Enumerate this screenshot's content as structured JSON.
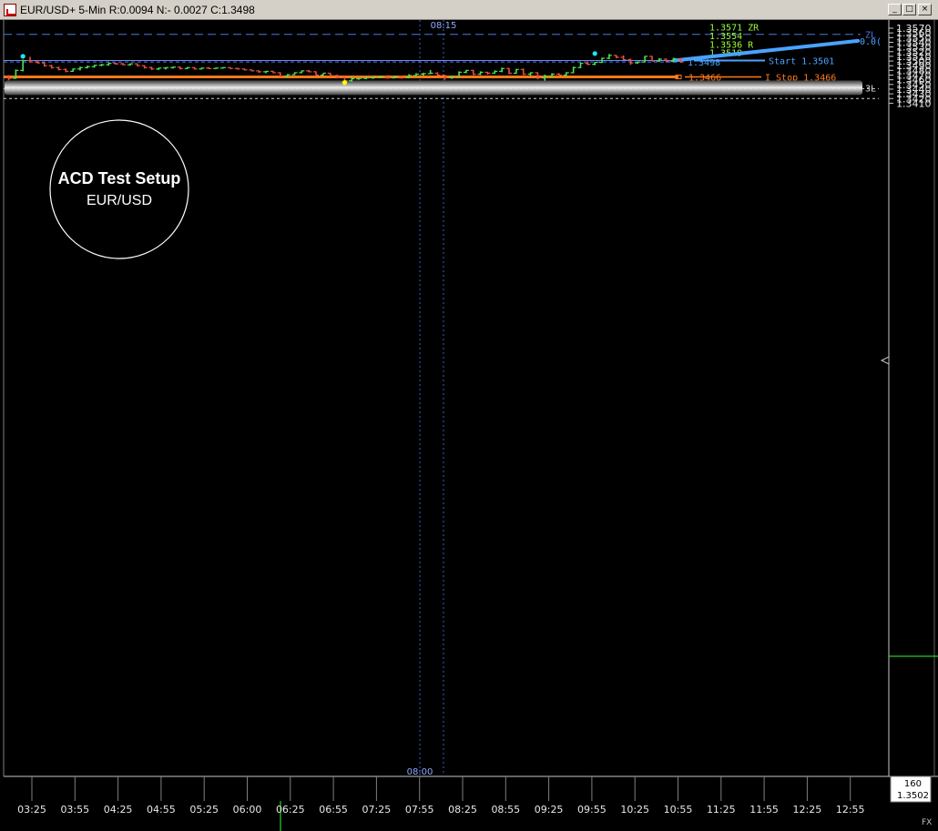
{
  "window": {
    "title": "EUR/USD+ 5-Min R:0.0094 N:- 0.0027 C:1.3498",
    "buttons": {
      "minimize": "_",
      "maximize": "□",
      "close": "×"
    }
  },
  "badge": {
    "line1": "ACD Test Setup",
    "line2": "EUR/USD"
  },
  "top_time_marker": "08:15",
  "bottom_time_marker": "08:00",
  "status_box": {
    "line1": "160",
    "line2": "1.3502"
  },
  "fx_label": "FX",
  "colors": {
    "up_bar": "#4fe34f",
    "down_bar": "#e8503c",
    "stop_line": "#ff7a1a",
    "projection": "#4aa3ff",
    "level_text": "#9cff3c",
    "marker_cyan": "#22e3f0",
    "marker_yellow": "#ffff00",
    "blue_line": "#4a78e0"
  },
  "chart_data": {
    "type": "bar",
    "title": "EUR/USD+ 5-Min",
    "ylim": [
      1.3405,
      1.3575
    ],
    "y_ticks": [
      "1.3570",
      "1.3560",
      "1.3550",
      "1.3540",
      "1.3530",
      "1.3520",
      "1.3510",
      "1.3500",
      "1.3490",
      "1.3480",
      "1.3470",
      "1.3460",
      "1.3450",
      "1.3440",
      "1.3430",
      "1.3420",
      "1.3410"
    ],
    "x_ticks": [
      "03:25",
      "03:55",
      "04:25",
      "04:55",
      "05:25",
      "06:00",
      "06:25",
      "06:55",
      "07:25",
      "07:55",
      "08:25",
      "08:55",
      "09:25",
      "09:55",
      "10:25",
      "10:55",
      "11:25",
      "11:55",
      "12:25",
      "12:55"
    ],
    "bars_ohlc": [
      [
        1.3466,
        1.347,
        1.3459,
        1.3463
      ],
      [
        1.3463,
        1.3482,
        1.3462,
        1.348
      ],
      [
        1.348,
        1.3503,
        1.3478,
        1.3501
      ],
      [
        1.3501,
        1.3509,
        1.3497,
        1.3498
      ],
      [
        1.3498,
        1.3502,
        1.3495,
        1.3496
      ],
      [
        1.3496,
        1.3497,
        1.3488,
        1.349
      ],
      [
        1.349,
        1.3492,
        1.3484,
        1.3486
      ],
      [
        1.3486,
        1.3488,
        1.348,
        1.3482
      ],
      [
        1.3482,
        1.3484,
        1.3476,
        1.3478
      ],
      [
        1.3478,
        1.3484,
        1.3477,
        1.3483
      ],
      [
        1.3483,
        1.3488,
        1.348,
        1.3486
      ],
      [
        1.3486,
        1.349,
        1.3484,
        1.3488
      ],
      [
        1.3488,
        1.3492,
        1.3486,
        1.3491
      ],
      [
        1.3491,
        1.3494,
        1.3489,
        1.3492
      ],
      [
        1.3492,
        1.3497,
        1.349,
        1.3495
      ],
      [
        1.3495,
        1.3496,
        1.3492,
        1.3494
      ],
      [
        1.3494,
        1.3496,
        1.3491,
        1.3492
      ],
      [
        1.3492,
        1.3495,
        1.349,
        1.3494
      ],
      [
        1.3494,
        1.3495,
        1.3489,
        1.349
      ],
      [
        1.349,
        1.3491,
        1.3484,
        1.3486
      ],
      [
        1.3486,
        1.3488,
        1.3481,
        1.3483
      ],
      [
        1.3483,
        1.3486,
        1.3481,
        1.3485
      ],
      [
        1.3485,
        1.3487,
        1.3482,
        1.3486
      ],
      [
        1.3486,
        1.3488,
        1.3484,
        1.3487
      ],
      [
        1.3487,
        1.3488,
        1.3482,
        1.3484
      ],
      [
        1.3484,
        1.3487,
        1.3483,
        1.3486
      ],
      [
        1.3486,
        1.3487,
        1.3482,
        1.3483
      ],
      [
        1.3483,
        1.3486,
        1.3482,
        1.3485
      ],
      [
        1.3485,
        1.3487,
        1.3483,
        1.3484
      ],
      [
        1.3484,
        1.3486,
        1.3483,
        1.3485
      ],
      [
        1.3485,
        1.3487,
        1.3484,
        1.3486
      ],
      [
        1.3486,
        1.3487,
        1.3483,
        1.3484
      ],
      [
        1.3484,
        1.3486,
        1.3482,
        1.3483
      ],
      [
        1.3483,
        1.3484,
        1.348,
        1.3481
      ],
      [
        1.3481,
        1.3482,
        1.3478,
        1.3479
      ],
      [
        1.3479,
        1.348,
        1.3475,
        1.3477
      ],
      [
        1.3477,
        1.3479,
        1.3474,
        1.3478
      ],
      [
        1.3478,
        1.3479,
        1.3474,
        1.3475
      ],
      [
        1.3475,
        1.3476,
        1.3466,
        1.3468
      ],
      [
        1.3468,
        1.3472,
        1.3465,
        1.3471
      ],
      [
        1.3471,
        1.3476,
        1.347,
        1.3475
      ],
      [
        1.3475,
        1.348,
        1.3474,
        1.3479
      ],
      [
        1.3479,
        1.3481,
        1.3476,
        1.3477
      ],
      [
        1.3477,
        1.3478,
        1.3468,
        1.347
      ],
      [
        1.347,
        1.3474,
        1.3468,
        1.3474
      ],
      [
        1.3474,
        1.3475,
        1.3467,
        1.3469
      ],
      [
        1.3469,
        1.3471,
        1.3463,
        1.3465
      ],
      [
        1.3465,
        1.3467,
        1.3455,
        1.3458
      ],
      [
        1.3458,
        1.3467,
        1.3456,
        1.3462
      ],
      [
        1.3462,
        1.3465,
        1.346,
        1.3463
      ],
      [
        1.3463,
        1.3466,
        1.3461,
        1.3464
      ],
      [
        1.3464,
        1.3467,
        1.3462,
        1.3466
      ],
      [
        1.3466,
        1.3468,
        1.3464,
        1.3467
      ],
      [
        1.3467,
        1.347,
        1.3462,
        1.3464
      ],
      [
        1.3464,
        1.3468,
        1.3463,
        1.3467
      ],
      [
        1.3467,
        1.3468,
        1.3462,
        1.3465
      ],
      [
        1.3465,
        1.3472,
        1.3463,
        1.3469
      ],
      [
        1.3469,
        1.3474,
        1.3467,
        1.3472
      ],
      [
        1.3472,
        1.3475,
        1.3469,
        1.3473
      ],
      [
        1.3473,
        1.3481,
        1.3472,
        1.3474
      ],
      [
        1.3474,
        1.3476,
        1.3469,
        1.347
      ],
      [
        1.347,
        1.3471,
        1.346,
        1.3465
      ],
      [
        1.3465,
        1.3468,
        1.3462,
        1.3467
      ],
      [
        1.3467,
        1.3478,
        1.3466,
        1.3476
      ],
      [
        1.3476,
        1.3481,
        1.3474,
        1.348
      ],
      [
        1.348,
        1.3481,
        1.347,
        1.3472
      ],
      [
        1.3472,
        1.3478,
        1.347,
        1.3476
      ],
      [
        1.3476,
        1.3477,
        1.3471,
        1.3474
      ],
      [
        1.3474,
        1.348,
        1.3473,
        1.3478
      ],
      [
        1.3478,
        1.3486,
        1.3476,
        1.3484
      ],
      [
        1.3484,
        1.3485,
        1.3472,
        1.3474
      ],
      [
        1.3474,
        1.3483,
        1.3473,
        1.3482
      ],
      [
        1.3482,
        1.3484,
        1.347,
        1.3472
      ],
      [
        1.3472,
        1.3476,
        1.3469,
        1.3475
      ],
      [
        1.3475,
        1.3476,
        1.3461,
        1.3464
      ],
      [
        1.3464,
        1.3471,
        1.3458,
        1.3468
      ],
      [
        1.3468,
        1.3474,
        1.3466,
        1.3472
      ],
      [
        1.3472,
        1.3474,
        1.3467,
        1.347
      ],
      [
        1.347,
        1.3476,
        1.3468,
        1.3475
      ],
      [
        1.3475,
        1.3488,
        1.3474,
        1.3486
      ],
      [
        1.3486,
        1.3497,
        1.3485,
        1.3495
      ],
      [
        1.3495,
        1.3499,
        1.3491,
        1.3493
      ],
      [
        1.3493,
        1.3498,
        1.3491,
        1.3497
      ],
      [
        1.3497,
        1.3507,
        1.3496,
        1.3506
      ],
      [
        1.3506,
        1.3515,
        1.3504,
        1.3512
      ],
      [
        1.3512,
        1.3513,
        1.3506,
        1.3508
      ],
      [
        1.3508,
        1.3512,
        1.3502,
        1.3503
      ],
      [
        1.3503,
        1.3505,
        1.3492,
        1.3496
      ],
      [
        1.3496,
        1.3499,
        1.3494,
        1.3498
      ],
      [
        1.3498,
        1.3511,
        1.3497,
        1.351
      ],
      [
        1.351,
        1.3511,
        1.3499,
        1.35
      ],
      [
        1.35,
        1.3506,
        1.3498,
        1.3504
      ],
      [
        1.3504,
        1.3505,
        1.3497,
        1.3499
      ],
      [
        1.3499,
        1.3507,
        1.3498,
        1.3505
      ],
      [
        1.3505,
        1.3506,
        1.3496,
        1.3498
      ]
    ],
    "levels": [
      {
        "name": "ZL",
        "label": "ZL",
        "price": 1.3557,
        "style": "dashed",
        "color": "#4a78e0"
      },
      {
        "name": "Start",
        "label": "Start 1.3501",
        "price": 1.3501,
        "color": "#4aa3ff"
      },
      {
        "name": "Close",
        "label": "1.3498",
        "price": 1.3498,
        "color": "#4aa3ff"
      },
      {
        "name": "I Stop",
        "label": "I Stop 1.3466",
        "price": 1.3466,
        "color": "#ff7a1a"
      },
      {
        "name": "3L",
        "label": "3L",
        "price": 1.3443
      },
      {
        "name": "dotted",
        "label": "",
        "price": 1.3441
      },
      {
        "name": "dotted",
        "label": "",
        "price": 1.342
      }
    ],
    "targets": [
      {
        "label": "1.3571 ZR",
        "price": 1.3573
      },
      {
        "label": "1.3554",
        "price": 1.3554
      },
      {
        "label": "1.3536 R",
        "price": 1.3536
      },
      {
        "label": "1.3519",
        "price": 1.3519
      }
    ],
    "stop_marker_label": "1.3466",
    "projection": {
      "from": 1.3501,
      "to": 1.3543,
      "label": "0.0("
    },
    "markers": [
      {
        "bar": 2,
        "price": 1.351,
        "color": "#22e3f0"
      },
      {
        "bar": 82,
        "price": 1.3516,
        "color": "#22e3f0"
      },
      {
        "bar": 47,
        "price": 1.3454,
        "color": "#ffff00"
      }
    ],
    "grid": false
  }
}
